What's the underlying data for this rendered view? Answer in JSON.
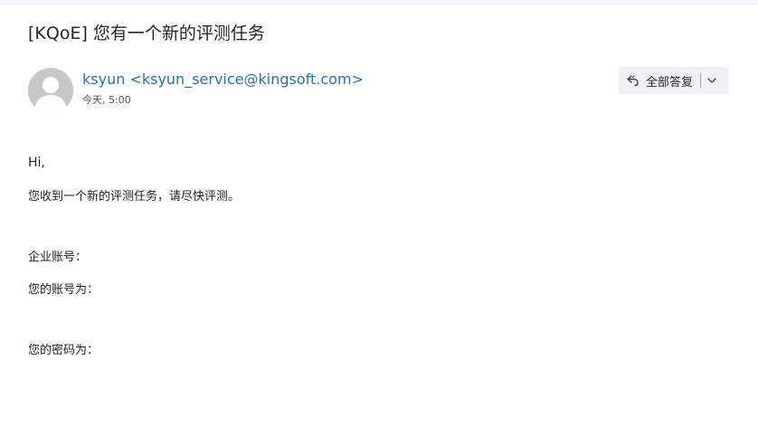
{
  "email": {
    "subject": "[KQoE] 您有一个新的评测任务",
    "sender": "ksyun <ksyun_service@kingsoft.com>",
    "date": "今天, 5:00",
    "toolbar": {
      "reply_all_label": "全部答复",
      "reply_icon": "reply-all-icon",
      "dropdown_icon": "chevron-down-icon"
    },
    "body": {
      "greeting": "Hi,",
      "intro": "您收到一个新的评测任务，请尽快评测。",
      "company_account_label": "企业账号：",
      "account_label": "您的账号为：",
      "password_label": "您的密码为："
    }
  },
  "colors": {
    "sender_link": "#2c6ea6",
    "reply_button_bg": "#eef2f7",
    "avatar_bg": "#c7c7c7"
  }
}
